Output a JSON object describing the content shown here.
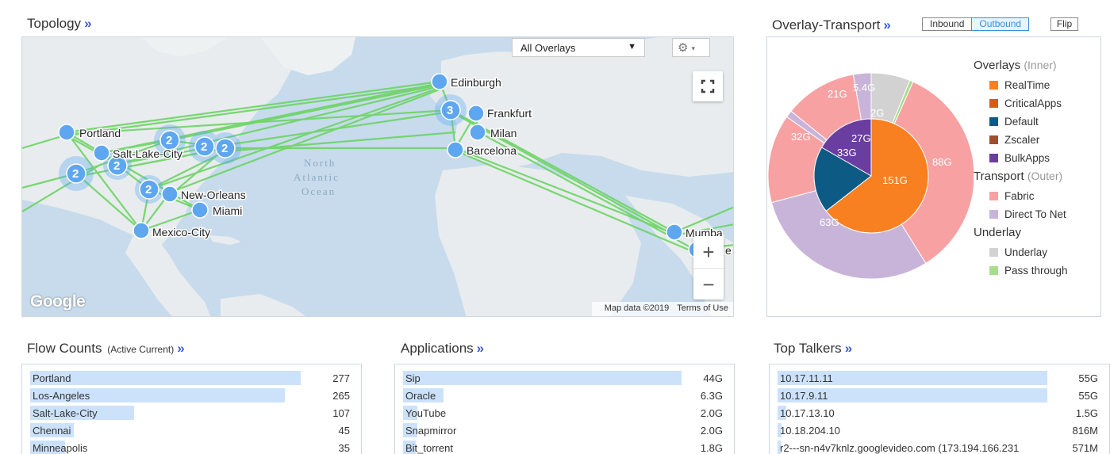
{
  "topology": {
    "title": "Topology",
    "chevron": "»",
    "overlay_select": "All Overlays",
    "dropdown_arrow": "▼",
    "gear_icon": "⚙",
    "gear_caret": "▾",
    "zoom_in": "+",
    "zoom_out": "−",
    "map_data": "Map data ©2019",
    "terms": "Terms of Use",
    "google": "Google",
    "ocean_line1": "North",
    "ocean_line2": "Atlantic",
    "ocean_line3": "Ocean",
    "cities": {
      "edinburgh": "Edinburgh",
      "frankfurt": "Frankfurt",
      "milan": "Milan",
      "barcelona": "Barcelona",
      "portland": "Portland",
      "salt_lake_city": "Salt-Lake-City",
      "new_orleans": "New-Orleans",
      "miami": "Miami",
      "mexico_city": "Mexico-City",
      "mumbai": "Mumba",
      "partial": "e"
    },
    "clusters": {
      "europe": "3",
      "east1": "2",
      "east2": "2",
      "east3": "2",
      "west": "2",
      "west2": "2",
      "south": "2"
    }
  },
  "overlay_transport": {
    "title": "Overlay-Transport",
    "chevron": "»",
    "inbound": "Inbound",
    "outbound": "Outbound",
    "flip": "Flip",
    "legend": {
      "overlays": "Overlays",
      "overlays_hint": "(Inner)",
      "realtime": "RealTime",
      "criticalapps": "CriticalApps",
      "default": "Default",
      "zscaler": "Zscaler",
      "bulkapps": "BulkApps",
      "transport": "Transport",
      "transport_hint": "(Outer)",
      "fabric": "Fabric",
      "direct_to_net": "Direct To Net",
      "underlay_group": "Underlay",
      "underlay": "Underlay",
      "pass_through": "Pass through"
    },
    "colors": {
      "realtime": "#f98020",
      "criticalapps": "#d85a17",
      "default": "#0d5a84",
      "zscaler": "#a14e2c",
      "bulkapps": "#6a3ea1",
      "fabric": "#f7a1a3",
      "direct_to_net": "#c9b4d9",
      "underlay": "#d2d2d2",
      "pass_through": "#a9dd8e"
    },
    "labels": {
      "outer_88": "88G",
      "outer_63": "63G",
      "outer_32": "32G",
      "outer_21": "21G",
      "outer_54": "5.4G",
      "outer_2": "2G",
      "inner_151": "151G",
      "inner_33": "33G",
      "inner_27": "27G"
    }
  },
  "flow_counts": {
    "title": "Flow Counts",
    "subtitle": "(Active Current)",
    "chevron": "»",
    "rows": [
      {
        "name": "Portland",
        "value": "277"
      },
      {
        "name": "Los-Angeles",
        "value": "265"
      },
      {
        "name": "Salt-Lake-City",
        "value": "107"
      },
      {
        "name": "Chennai",
        "value": "45"
      },
      {
        "name": "Minneapolis",
        "value": "35"
      }
    ],
    "fill": [
      0.86,
      0.81,
      0.33,
      0.14,
      0.11
    ]
  },
  "applications": {
    "title": "Applications",
    "chevron": "»",
    "rows": [
      {
        "name": "Sip",
        "value": "44G"
      },
      {
        "name": "Oracle",
        "value": "6.3G"
      },
      {
        "name": "YouTube",
        "value": "2.0G"
      },
      {
        "name": "Snapmirror",
        "value": "2.0G"
      },
      {
        "name": "Bit_torrent",
        "value": "1.8G"
      }
    ],
    "fill": [
      0.9,
      0.13,
      0.045,
      0.045,
      0.04
    ]
  },
  "top_talkers": {
    "title": "Top Talkers",
    "chevron": "»",
    "rows": [
      {
        "name": "10.17.11.11",
        "value": "55G"
      },
      {
        "name": "10.17.9.11",
        "value": "55G"
      },
      {
        "name": "10.17.13.10",
        "value": "1.5G"
      },
      {
        "name": "10.18.204.10",
        "value": "816M"
      },
      {
        "name": "r2---sn-n4v7knlz.googlevideo.com (173.194.166.231",
        "value": "571M"
      }
    ],
    "fill": [
      0.96,
      0.96,
      0.03,
      0.015,
      0.01
    ]
  }
}
